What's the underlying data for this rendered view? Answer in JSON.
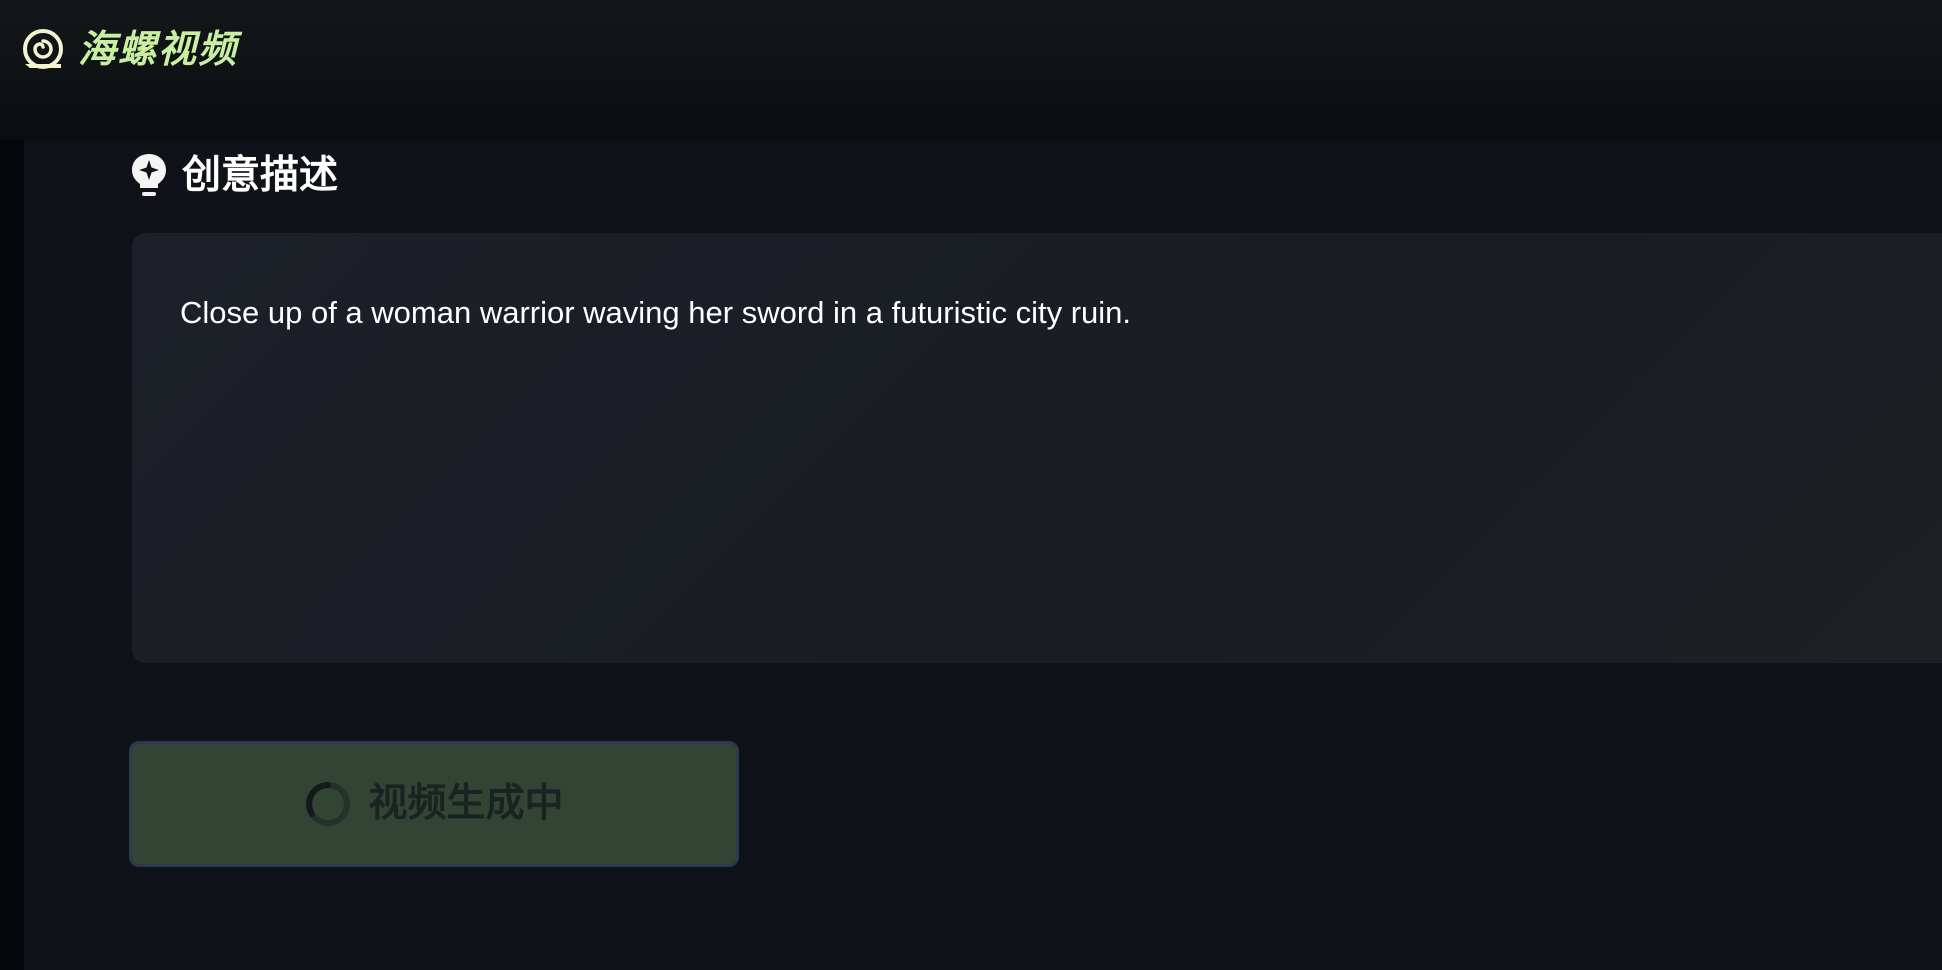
{
  "app": {
    "logo_text": "海螺视频",
    "logo_icon": "snail-shell-icon",
    "brand_color": "#c8f0a0"
  },
  "section": {
    "title": "创意描述",
    "icon": "lightbulb-sparkle-icon"
  },
  "prompt": {
    "value": "Close up of a woman warrior waving her sword in a futuristic city ruin."
  },
  "generate_button": {
    "label": "视频生成中",
    "state": "loading",
    "icon": "spinner-icon",
    "background_color": "#324434"
  }
}
